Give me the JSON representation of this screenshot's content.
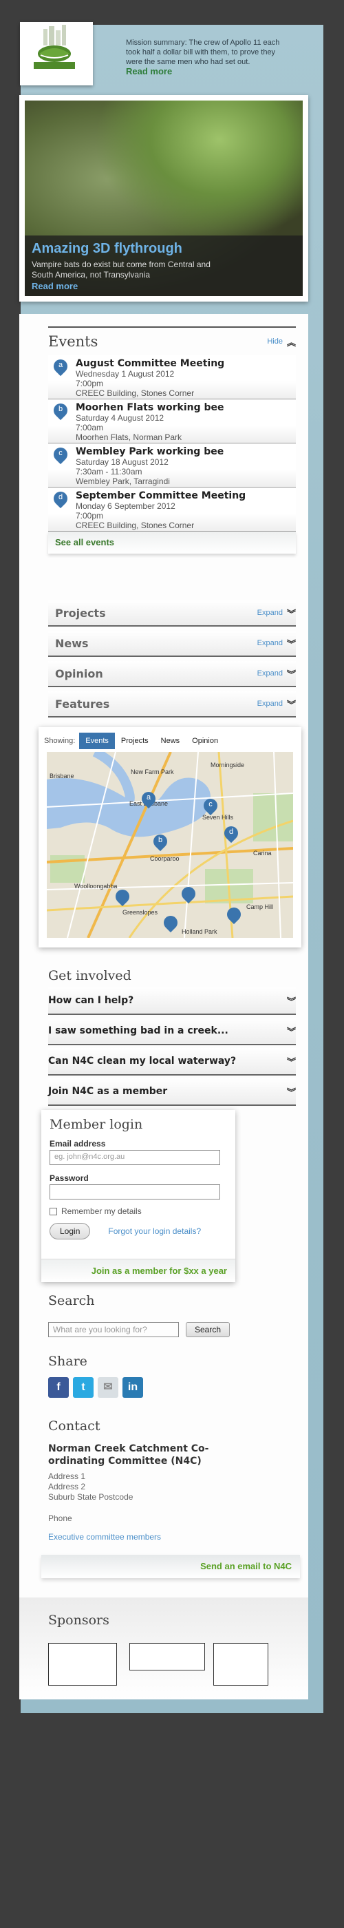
{
  "header": {
    "mission_text": "Mission summary: The crew of Apollo 11 each took half a dollar bill with them, to prove they were the same men who had set out.",
    "mission_more": "Read more"
  },
  "hero": {
    "title": "Amazing 3D flythrough",
    "subtitle": "Vampire bats do exist but come from Central and South America, not Transylvania",
    "more": "Read more"
  },
  "events": {
    "title": "Events",
    "toggle": "Hide",
    "items": [
      {
        "pin": "a",
        "title": "August Committee Meeting",
        "date": "Wednesday 1 August 2012",
        "time": "7:00pm",
        "place": "CREEC Building, Stones Corner"
      },
      {
        "pin": "b",
        "title": "Moorhen Flats working bee",
        "date": "Saturday 4 August 2012",
        "time": "7:00am",
        "place": "Moorhen Flats, Norman Park"
      },
      {
        "pin": "c",
        "title": "Wembley Park working bee",
        "date": "Saturday 18 August 2012",
        "time": "7:30am - 11:30am",
        "place": "Wembley Park, Tarragindi"
      },
      {
        "pin": "d",
        "title": "September Committee Meeting",
        "date": "Monday 6 September 2012",
        "time": "7:00pm",
        "place": "CREEC Building, Stones Corner"
      }
    ],
    "see_all": "See all events"
  },
  "sections": [
    {
      "title": "Projects",
      "toggle": "Expand"
    },
    {
      "title": "News",
      "toggle": "Expand"
    },
    {
      "title": "Opinion",
      "toggle": "Expand"
    },
    {
      "title": "Features",
      "toggle": "Expand"
    }
  ],
  "map": {
    "showing_label": "Showing:",
    "tabs": [
      "Events",
      "Projects",
      "News",
      "Opinion"
    ],
    "active_tab": "Events",
    "labels": [
      "Brisbane",
      "Morningside",
      "Seven Hills",
      "Woolloongabba",
      "Greenslopes",
      "Holland Park",
      "Carina",
      "Camp Hill",
      "East Brisbane",
      "Coorparoo",
      "New Farm Park"
    ]
  },
  "involved": {
    "title": "Get involved",
    "items": [
      "How can I help?",
      "I saw something bad in a creek...",
      "Can N4C clean my local waterway?",
      "Join N4C as a member"
    ]
  },
  "login": {
    "title": "Member login",
    "email_label": "Email address",
    "email_placeholder": "eg. john@n4c.org.au",
    "password_label": "Password",
    "remember": "Remember my details",
    "login_button": "Login",
    "forgot": "Forgot your login details?",
    "join": "Join as a member for $xx a year"
  },
  "search": {
    "title": "Search",
    "placeholder": "What are you looking for?",
    "button": "Search"
  },
  "share": {
    "title": "Share",
    "icons": [
      {
        "name": "facebook-icon",
        "glyph": "f",
        "color": "#3b5998"
      },
      {
        "name": "twitter-icon",
        "glyph": "t",
        "color": "#2ba9e1"
      },
      {
        "name": "email-icon",
        "glyph": "✉",
        "color": "#d9dfe3"
      },
      {
        "name": "linkedin-icon",
        "glyph": "in",
        "color": "#2a7bb3"
      }
    ]
  },
  "contact": {
    "title": "Contact",
    "name": "Norman Creek Catchment Co-ordinating Committee (N4C)",
    "address1": "Address 1",
    "address2": "Address 2",
    "address3": "Suburb State Postcode",
    "phone": "Phone",
    "exec_link": "Executive committee members",
    "email_link": "Send an email to N4C"
  },
  "sponsors": {
    "title": "Sponsors"
  },
  "colors": {
    "accent_blue": "#3a74ad",
    "link_blue": "#4b8fc9",
    "green": "#5aa126",
    "bg": "#3d3d3d"
  }
}
